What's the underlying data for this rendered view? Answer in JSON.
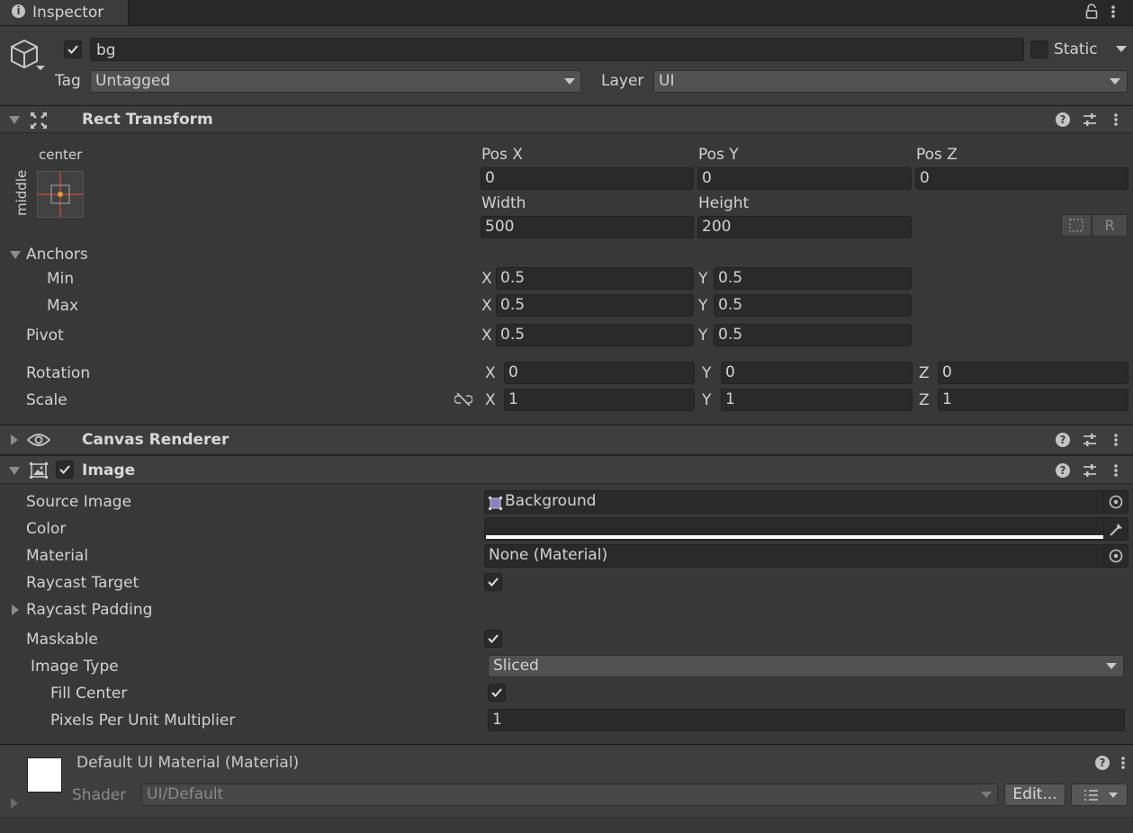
{
  "tab": {
    "title": "Inspector"
  },
  "object": {
    "name": "bg",
    "static_label": "Static",
    "tag_label": "Tag",
    "tag_value": "Untagged",
    "layer_label": "Layer",
    "layer_value": "UI"
  },
  "rect_transform": {
    "title": "Rect Transform",
    "anchor_preset_h": "center",
    "anchor_preset_v": "middle",
    "pos_x_label": "Pos X",
    "pos_y_label": "Pos Y",
    "pos_z_label": "Pos Z",
    "pos_x": "0",
    "pos_y": "0",
    "pos_z": "0",
    "width_label": "Width",
    "height_label": "Height",
    "width": "500",
    "height": "200",
    "anchors_label": "Anchors",
    "min_label": "Min",
    "max_label": "Max",
    "min_x": "0.5",
    "min_y": "0.5",
    "max_x": "0.5",
    "max_y": "0.5",
    "pivot_label": "Pivot",
    "pivot_x": "0.5",
    "pivot_y": "0.5",
    "rotation_label": "Rotation",
    "rot_x": "0",
    "rot_y": "0",
    "rot_z": "0",
    "scale_label": "Scale",
    "scale_x": "1",
    "scale_y": "1",
    "scale_z": "1",
    "raw_button": "R",
    "axis_x": "X",
    "axis_y": "Y",
    "axis_z": "Z"
  },
  "canvas_renderer": {
    "title": "Canvas Renderer"
  },
  "image": {
    "title": "Image",
    "source_image_label": "Source Image",
    "source_image_value": "Background",
    "color_label": "Color",
    "material_label": "Material",
    "material_value": "None (Material)",
    "raycast_target_label": "Raycast Target",
    "raycast_padding_label": "Raycast Padding",
    "maskable_label": "Maskable",
    "image_type_label": "Image Type",
    "image_type_value": "Sliced",
    "fill_center_label": "Fill Center",
    "ppu_label": "Pixels Per Unit Multiplier",
    "ppu_value": "1"
  },
  "material_preview": {
    "title": "Default UI Material (Material)",
    "shader_label": "Shader",
    "shader_value": "UI/Default",
    "edit_button": "Edit..."
  },
  "colors": {
    "bg": "#383838",
    "field": "#2a2a2a",
    "header": "#3e3e3e",
    "image_color": "#ffffff"
  }
}
